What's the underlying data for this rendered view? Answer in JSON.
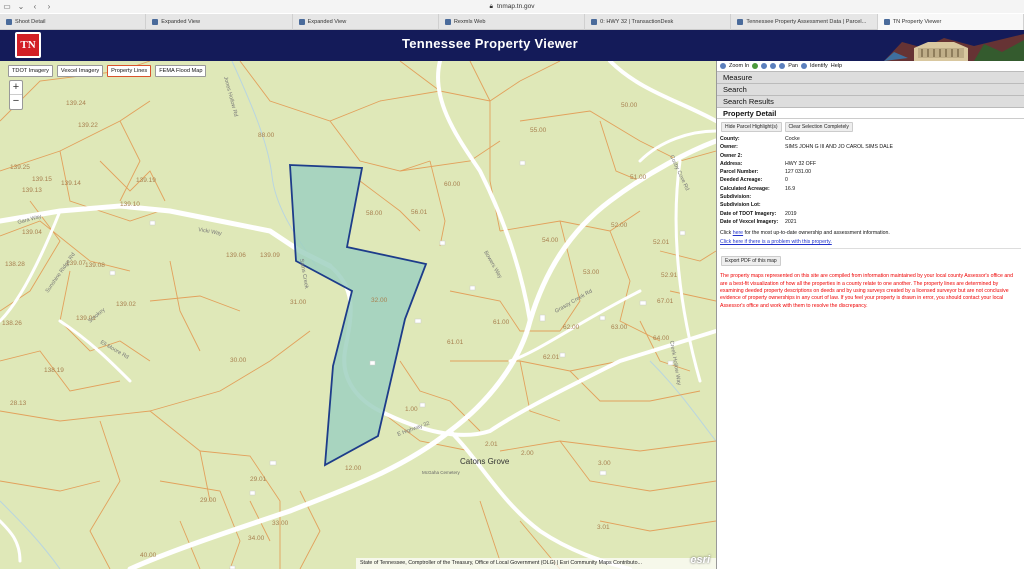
{
  "browser": {
    "url": "tnmap.tn.gov",
    "tabs": [
      {
        "label": "Shoot Detail",
        "icon": "photo-tab-icon"
      },
      {
        "label": "Expanded View",
        "icon": "page-tab-icon"
      },
      {
        "label": "Expanded View",
        "icon": "page-tab-icon"
      },
      {
        "label": "Rexmls Web",
        "icon": "globe-tab-icon"
      },
      {
        "label": "0: HWY 32 | TransactionDesk",
        "icon": "document-tab-icon"
      },
      {
        "label": "Tennessee Property Assessment Data | Parcel...",
        "icon": "seal-tab-icon"
      },
      {
        "label": "TN Property Viewer",
        "icon": "seal-tab-icon",
        "active": true
      }
    ]
  },
  "header": {
    "logo_text": "TN",
    "title": "Tennessee Property Viewer"
  },
  "map": {
    "layer_buttons": [
      "TDOT Imagery",
      "Vexcel Imagery",
      "Property Lines",
      "FEMA Flood Map"
    ],
    "active_layer": "Property Lines",
    "zoom_in": "+",
    "zoom_out": "−",
    "place_label": "Catons Grove",
    "cemetery_label": "McGaha Cemetery",
    "roads": [
      "Gara Way",
      "Vicki Way",
      "Sunshine Ridge Rd",
      "Smokey",
      "Eli Moore Rd",
      "Jones Hollow Rd",
      "Sams Creek",
      "Bowers Way",
      "Cosby Cove Rd",
      "Grassy Creek Rd",
      "E Highway 32",
      "Creek Hollow Way"
    ],
    "parcel_labels": [
      "139.24",
      "139.22",
      "139.25",
      "139.15",
      "139.13",
      "139.14",
      "139.19",
      "139.10",
      "139.04",
      "139.07",
      "139.06",
      "139.09",
      "139.08",
      "139.02",
      "139.01",
      "138.26",
      "138.28",
      "138.19",
      "28.13",
      "29.00",
      "30.00",
      "31.00",
      "32.00",
      "40.00",
      "33.00",
      "34.00",
      "29.01",
      "12.00",
      "1.00",
      "61.01",
      "61.00",
      "62.00",
      "63.00",
      "64.00",
      "62.01",
      "53.00",
      "51.00",
      "52.00",
      "52.01",
      "52.91",
      "67.01",
      "50.00",
      "55.00",
      "58.00",
      "56.01",
      "60.00",
      "54.00",
      "3.00",
      "3.01",
      "2.01",
      "2.00",
      "88.00"
    ],
    "attribution": "State of Tennessee, Comptroller of the Treasury, Office of Local Government (OLG) | Esri Community Maps Contributo...",
    "esri_logo": "esri",
    "colors": {
      "base": "#dfe8b8",
      "parcel_line": "#e2a15c",
      "road": "#ffffff",
      "selected_fill": "#9fd0c0",
      "selected_outline": "#1d3c8a"
    }
  },
  "panel": {
    "tools": [
      "Zoom In",
      "Pan",
      "Identify",
      "Help"
    ],
    "sections": [
      "Measure",
      "Search",
      "Search Results",
      "Property Detail"
    ],
    "active_section": "Property Detail",
    "buttons": {
      "hide_parcel": "Hide Parcel Highlight(s)",
      "clear_selection": "Clear Selection Completely",
      "export_pdf": "Export PDF of this map"
    },
    "details": [
      {
        "label": "County:",
        "value": "Cocke"
      },
      {
        "label": "Owner:",
        "value": "SIMS JOHN G III AND JO CAROL SIMS DALE"
      },
      {
        "label": "Owner 2:",
        "value": ""
      },
      {
        "label": "Address:",
        "value": "HWY 32 OFF"
      },
      {
        "label": "Parcel Number:",
        "value": "127 031.00"
      },
      {
        "label": "Deeded Acreage:",
        "value": "0"
      },
      {
        "label": "Calculated Acreage:",
        "value": "16.9"
      },
      {
        "label": "Subdivision:",
        "value": ""
      },
      {
        "label": "Subdivision Lot:",
        "value": ""
      },
      {
        "label": "Date of TDOT Imagery:",
        "value": "2019"
      },
      {
        "label": "Date of Vexcel Imagery:",
        "value": "2021"
      }
    ],
    "click_prefix": "Click ",
    "click_link": "here",
    "click_suffix": " for the most up-to-date ownership and assessment information.",
    "problem_link": "Click here if there is a problem with this property.",
    "disclaimer": "The property maps represented on this site are compiled from information maintained by your local county Assessor's office and are a best-fit visualization of how all the properties in a county relate to one another. The property lines are determined by examining deeded property descriptions on deeds and by using surveys created by a licensed surveyor but are not conclusive evidence of property ownerships in any court of law. If you feel your property is drawn in error, you should contact your local Assessor's office and work with them to resolve the discrepancy."
  }
}
